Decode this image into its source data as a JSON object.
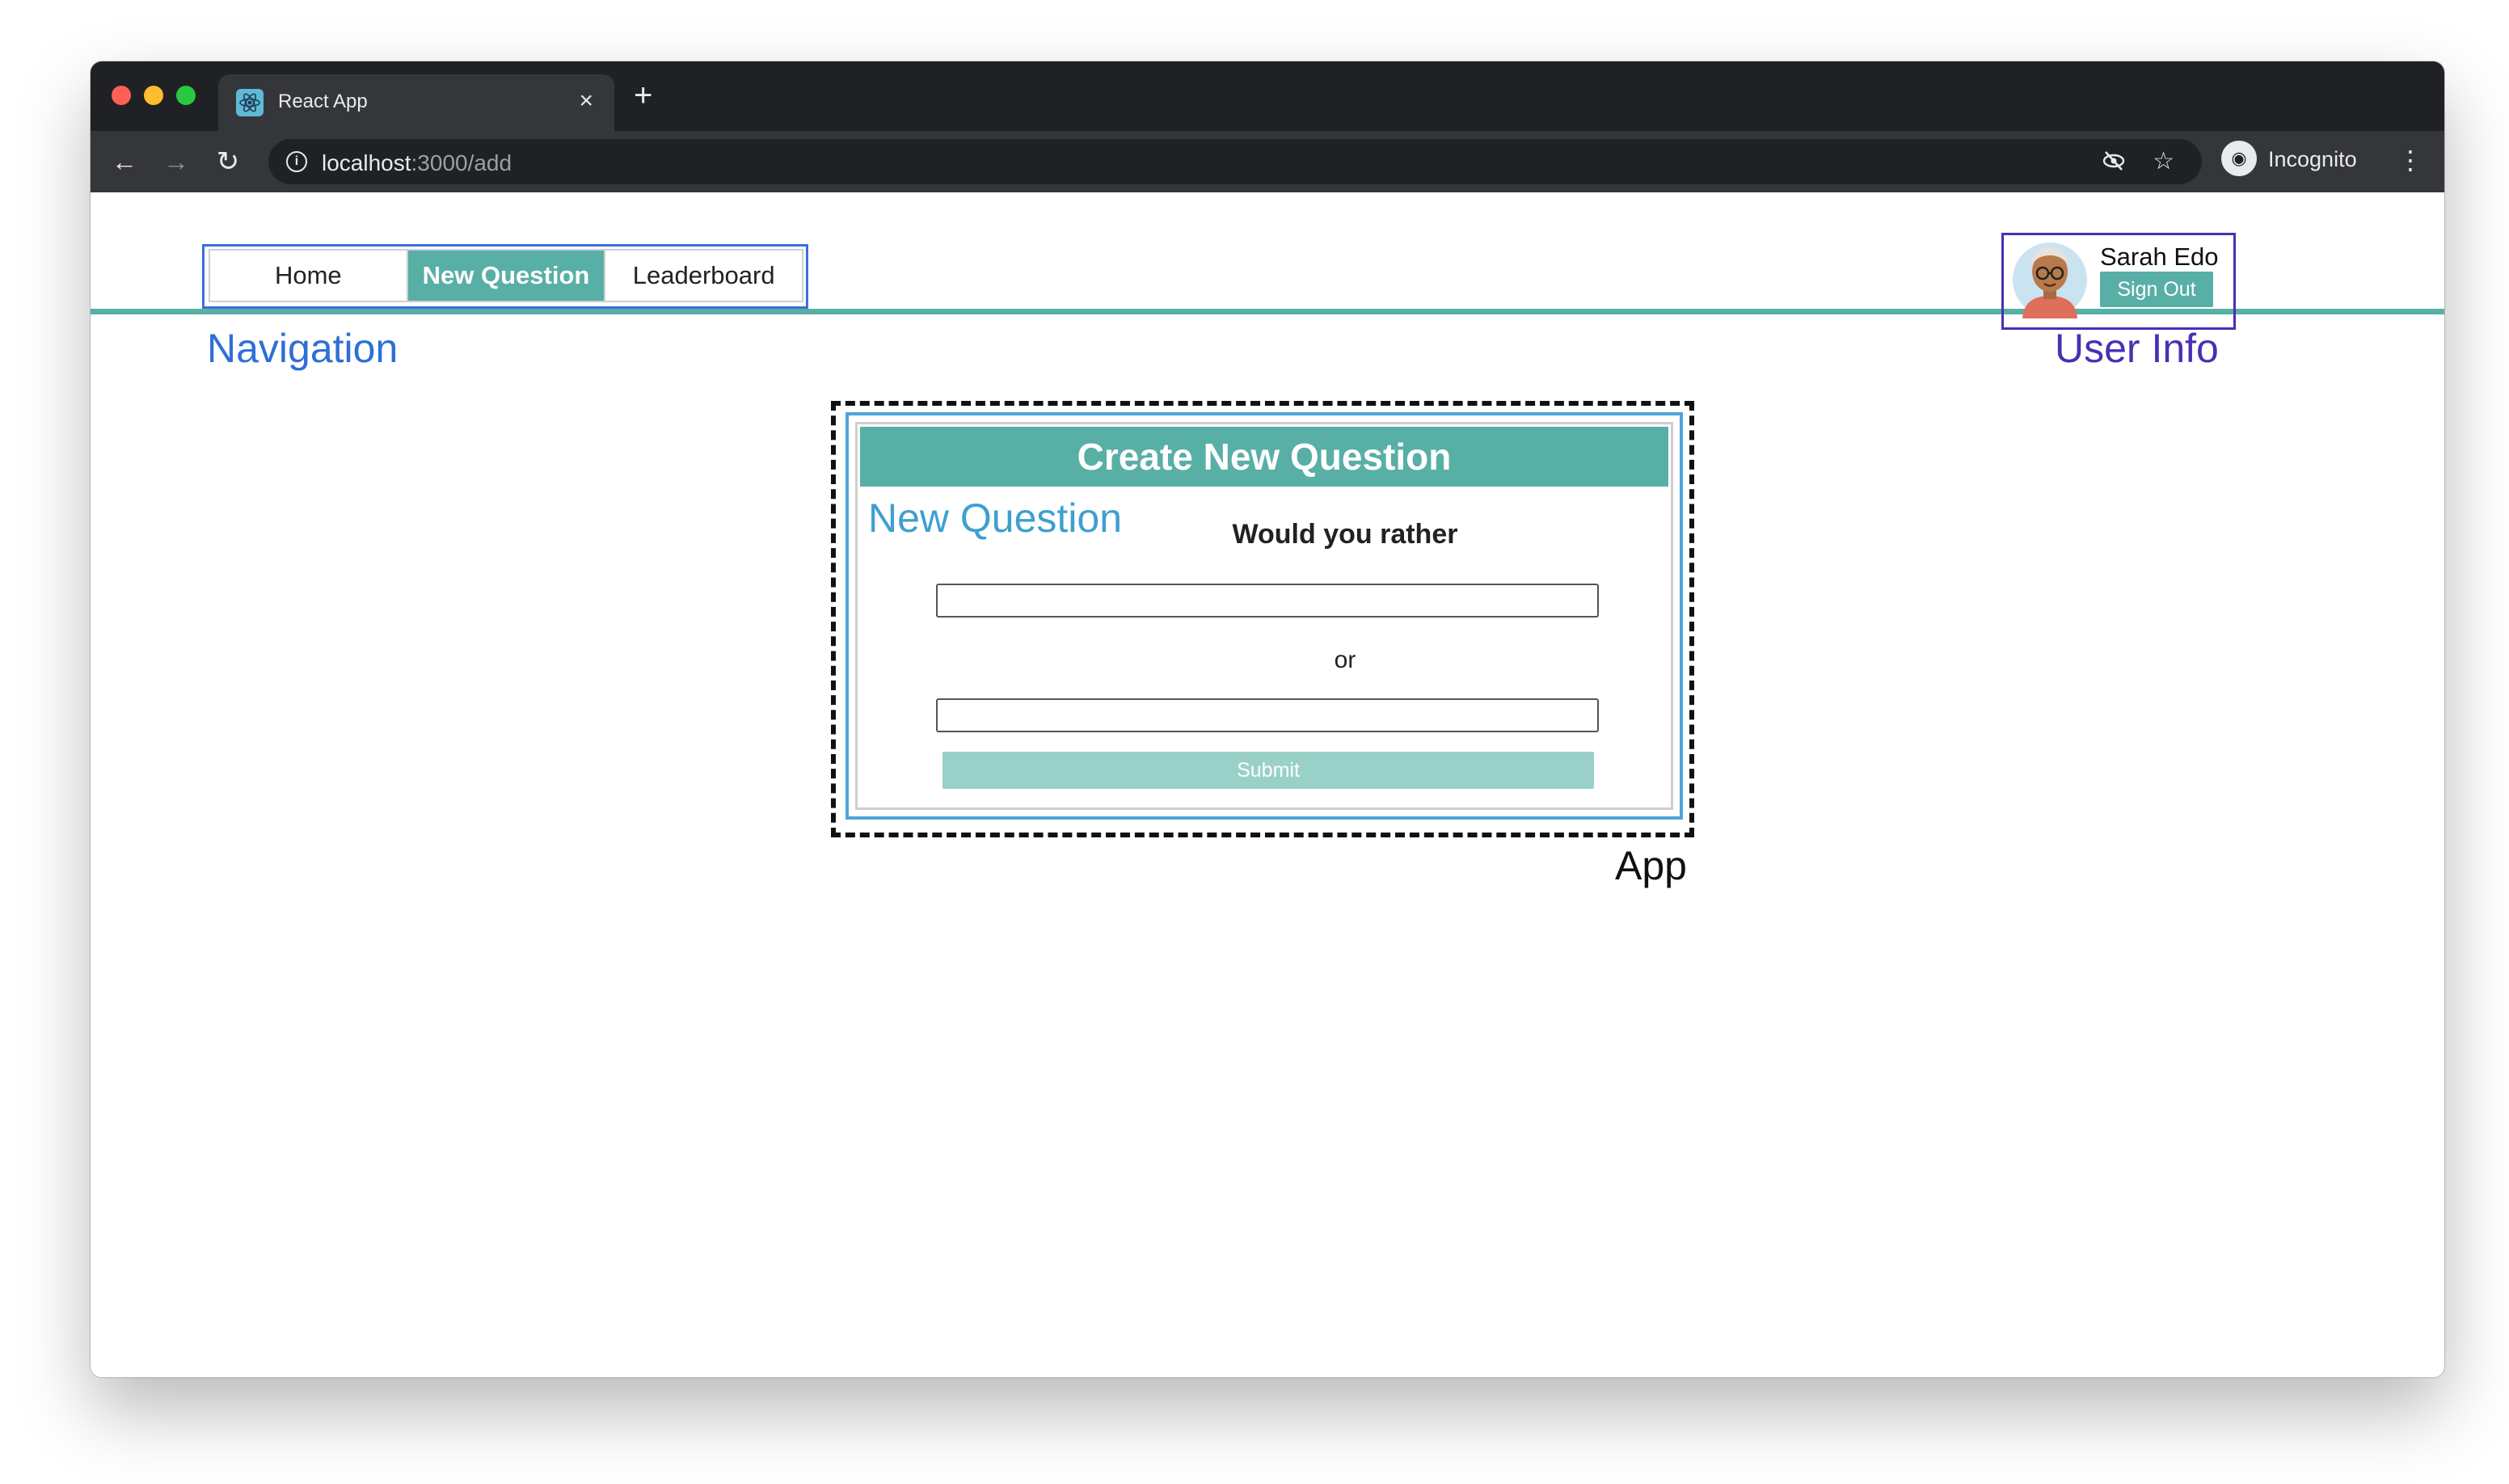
{
  "browser": {
    "tab_title": "React App",
    "tab_close_icon": "close-icon",
    "new_tab_icon": "plus-icon",
    "url_host": "localhost",
    "url_rest": ":3000/add",
    "incognito_label": "Incognito"
  },
  "nav": {
    "items": [
      {
        "label": "Home",
        "active": false
      },
      {
        "label": "New Question",
        "active": true
      },
      {
        "label": "Leaderboard",
        "active": false
      }
    ]
  },
  "user": {
    "name": "Sarah Edo",
    "sign_out_label": "Sign Out"
  },
  "form": {
    "header": "Create New Question",
    "prompt": "Would you rather",
    "separator": "or",
    "option_one_value": "",
    "option_two_value": "",
    "submit_label": "Submit"
  },
  "annotations": {
    "navigation": "Navigation",
    "user_info": "User Info",
    "new_question": "New Question",
    "app": "App"
  },
  "colors": {
    "accent": "#58afa6",
    "submit_disabled": "#99d1c9",
    "nav_annotation": "#3b6fe0",
    "user_annotation": "#4630b5",
    "question_annotation": "#4aa6d6"
  }
}
